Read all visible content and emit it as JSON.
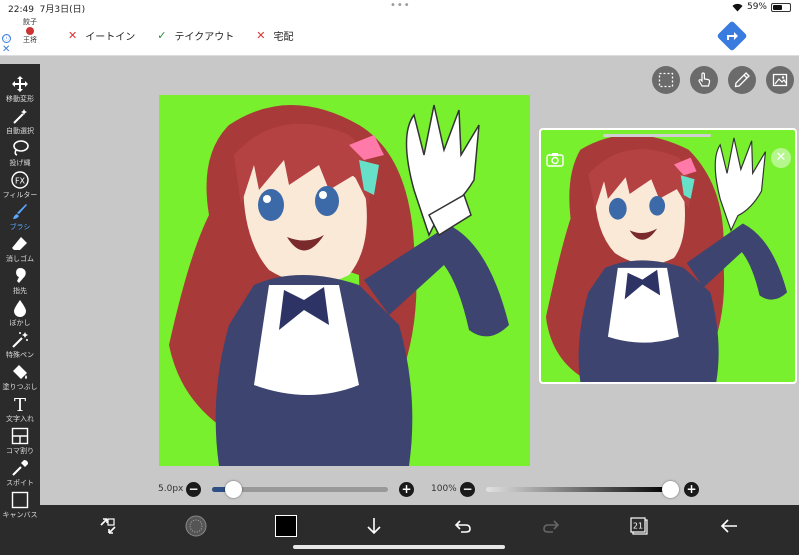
{
  "status": {
    "time": "22:49",
    "date": "7月3日(日)",
    "battery": "59%",
    "battery_level": 0.59
  },
  "ad": {
    "logo_top": "餃子",
    "logo_bottom": "王将",
    "info_symbol": "ⓘ",
    "close_symbol": "✕",
    "items": [
      {
        "mark": "✕",
        "label": "イートイン",
        "available": false
      },
      {
        "mark": "✓",
        "label": "テイクアウト",
        "available": true
      },
      {
        "mark": "✕",
        "label": "宅配",
        "available": false
      }
    ],
    "colors": {
      "unavailable": "#dd3333",
      "available": "#2a8a3a",
      "directions": "#3a7be0"
    }
  },
  "tools": [
    {
      "label": "移動変形",
      "icon": "move-icon"
    },
    {
      "label": "自動選択",
      "icon": "magic-wand-icon"
    },
    {
      "label": "投げ縄",
      "icon": "lasso-icon"
    },
    {
      "label": "フィルター",
      "icon": "fx-icon",
      "glyph": "FX"
    },
    {
      "label": "ブラシ",
      "icon": "brush-icon",
      "active": true
    },
    {
      "label": "消しゴム",
      "icon": "eraser-icon"
    },
    {
      "label": "指先",
      "icon": "smudge-icon"
    },
    {
      "label": "ぼかし",
      "icon": "blur-drop-icon"
    },
    {
      "label": "特殊ペン",
      "icon": "special-pen-icon"
    },
    {
      "label": "塗りつぶし",
      "icon": "bucket-icon"
    },
    {
      "label": "文字入れ",
      "icon": "text-icon",
      "glyph": "T"
    },
    {
      "label": "コマ割り",
      "icon": "frame-divide-icon"
    },
    {
      "label": "スポイト",
      "icon": "eyedropper-icon"
    },
    {
      "label": "キャンバス",
      "icon": "canvas-icon"
    }
  ],
  "top_buttons": [
    "selection-icon",
    "hand-touch-icon",
    "pen-tip-icon",
    "image-reference-icon"
  ],
  "brush": {
    "size_label": "5.0px",
    "size_fraction": 0.12,
    "opacity_label": "100%",
    "opacity_fraction": 1.0,
    "minus": "−",
    "plus": "+"
  },
  "bottom": {
    "layers_count": "21"
  },
  "colors": {
    "canvas_bg": "#79f02e",
    "active": "#5aa8ff",
    "toolbar": "#2b2b2b",
    "current_color": "#000000"
  }
}
